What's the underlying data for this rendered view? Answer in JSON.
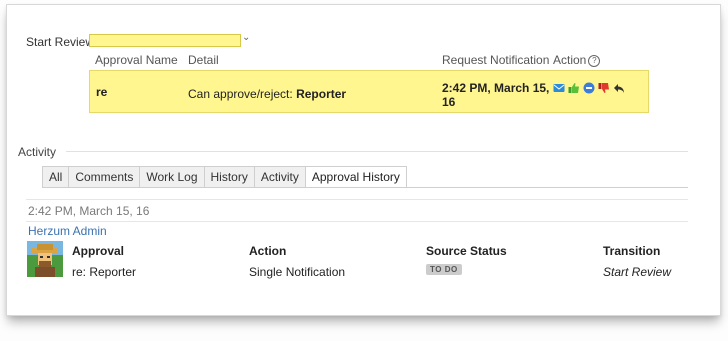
{
  "transition_selector": {
    "label": "Start Review",
    "value": ""
  },
  "approval_table": {
    "headers": {
      "name": "Approval Name",
      "detail": "Detail",
      "notification": "Request Notification",
      "action": "Action"
    },
    "row": {
      "name": "re",
      "detail_prefix": "Can approve/reject: ",
      "detail_role": "Reporter",
      "notification_line1": "2:42 PM, March 15,",
      "notification_line2": "16"
    },
    "action_icons": [
      "email-icon",
      "thumbs-up-icon",
      "minus-circle-icon",
      "thumbs-down-icon",
      "reply-icon"
    ]
  },
  "activity": {
    "title": "Activity",
    "tabs": [
      "All",
      "Comments",
      "Work Log",
      "History",
      "Activity",
      "Approval History"
    ],
    "active_tab": "Approval History"
  },
  "history": {
    "timestamp": "2:42 PM, March 15, 16",
    "user": "Herzum Admin",
    "columns": {
      "approval": "Approval",
      "action": "Action",
      "source_status": "Source Status",
      "transition": "Transition"
    },
    "entry": {
      "approval": "re: Reporter",
      "action": "Single Notification",
      "source_status": "TO DO",
      "transition": "Start Review"
    }
  },
  "colors": {
    "highlight": "#fff68f",
    "link": "#3b73af",
    "badge": "#cccccc"
  }
}
